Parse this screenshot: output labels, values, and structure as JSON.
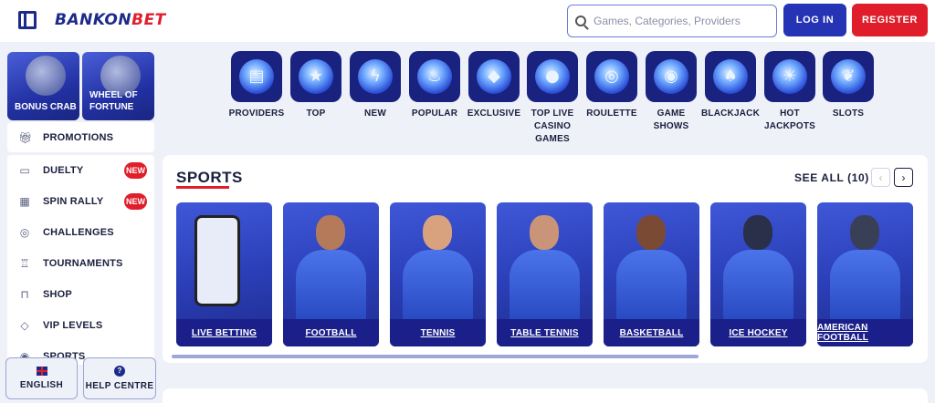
{
  "header": {
    "logo_part1": "BANKON",
    "logo_part2": "BET",
    "search_placeholder": "Games, Categories, Providers",
    "login_label": "LOG IN",
    "register_label": "REGISTER"
  },
  "sidebar": {
    "tiles": [
      {
        "label_line1": "BONUS CRAB",
        "label_line2": ""
      },
      {
        "label_line1": "WHEEL OF",
        "label_line2": "FORTUNE"
      }
    ],
    "promotions_label": "PROMOTIONS",
    "items": [
      {
        "label": "DUELTY",
        "icon": "monitor-icon",
        "badge": "NEW"
      },
      {
        "label": "SPIN RALLY",
        "icon": "slot-icon",
        "badge": "NEW"
      },
      {
        "label": "CHALLENGES",
        "icon": "medal-icon"
      },
      {
        "label": "TOURNAMENTS",
        "icon": "trophy-icon"
      },
      {
        "label": "SHOP",
        "icon": "bag-icon"
      },
      {
        "label": "VIP LEVELS",
        "icon": "diamond-icon"
      },
      {
        "label": "SPORTS",
        "icon": "ball-icon"
      }
    ],
    "language_label": "ENGLISH",
    "help_label": "HELP CENTRE"
  },
  "categories": [
    {
      "label": "PROVIDERS",
      "icon": "providers-icon"
    },
    {
      "label": "TOP",
      "icon": "star-icon"
    },
    {
      "label": "NEW",
      "icon": "lightning-icon"
    },
    {
      "label": "POPULAR",
      "icon": "flame-icon"
    },
    {
      "label": "EXCLUSIVE",
      "icon": "gem-icon"
    },
    {
      "label": "TOP LIVE CASINO GAMES",
      "icon": "live-casino-icon"
    },
    {
      "label": "ROULETTE",
      "icon": "roulette-icon"
    },
    {
      "label": "GAME SHOWS",
      "icon": "game-shows-icon"
    },
    {
      "label": "BLACKJACK",
      "icon": "cards-icon"
    },
    {
      "label": "HOT JACKPOTS",
      "icon": "jackpot-icon"
    },
    {
      "label": "SLOTS",
      "icon": "cherry-icon"
    }
  ],
  "sports": {
    "title": "SPORTS",
    "see_all": "SEE ALL (10)",
    "cards": [
      {
        "label": "LIVE BETTING"
      },
      {
        "label": "FOOTBALL"
      },
      {
        "label": "TENNIS"
      },
      {
        "label": "TABLE TENNIS"
      },
      {
        "label": "BASKETBALL"
      },
      {
        "label": "ICE HOCKEY"
      },
      {
        "label": "AMERICAN FOOTBALL"
      }
    ]
  },
  "colors": {
    "brand_blue": "#1c2a8a",
    "brand_red": "#e01e2b",
    "accent_blue": "#2534b5"
  }
}
